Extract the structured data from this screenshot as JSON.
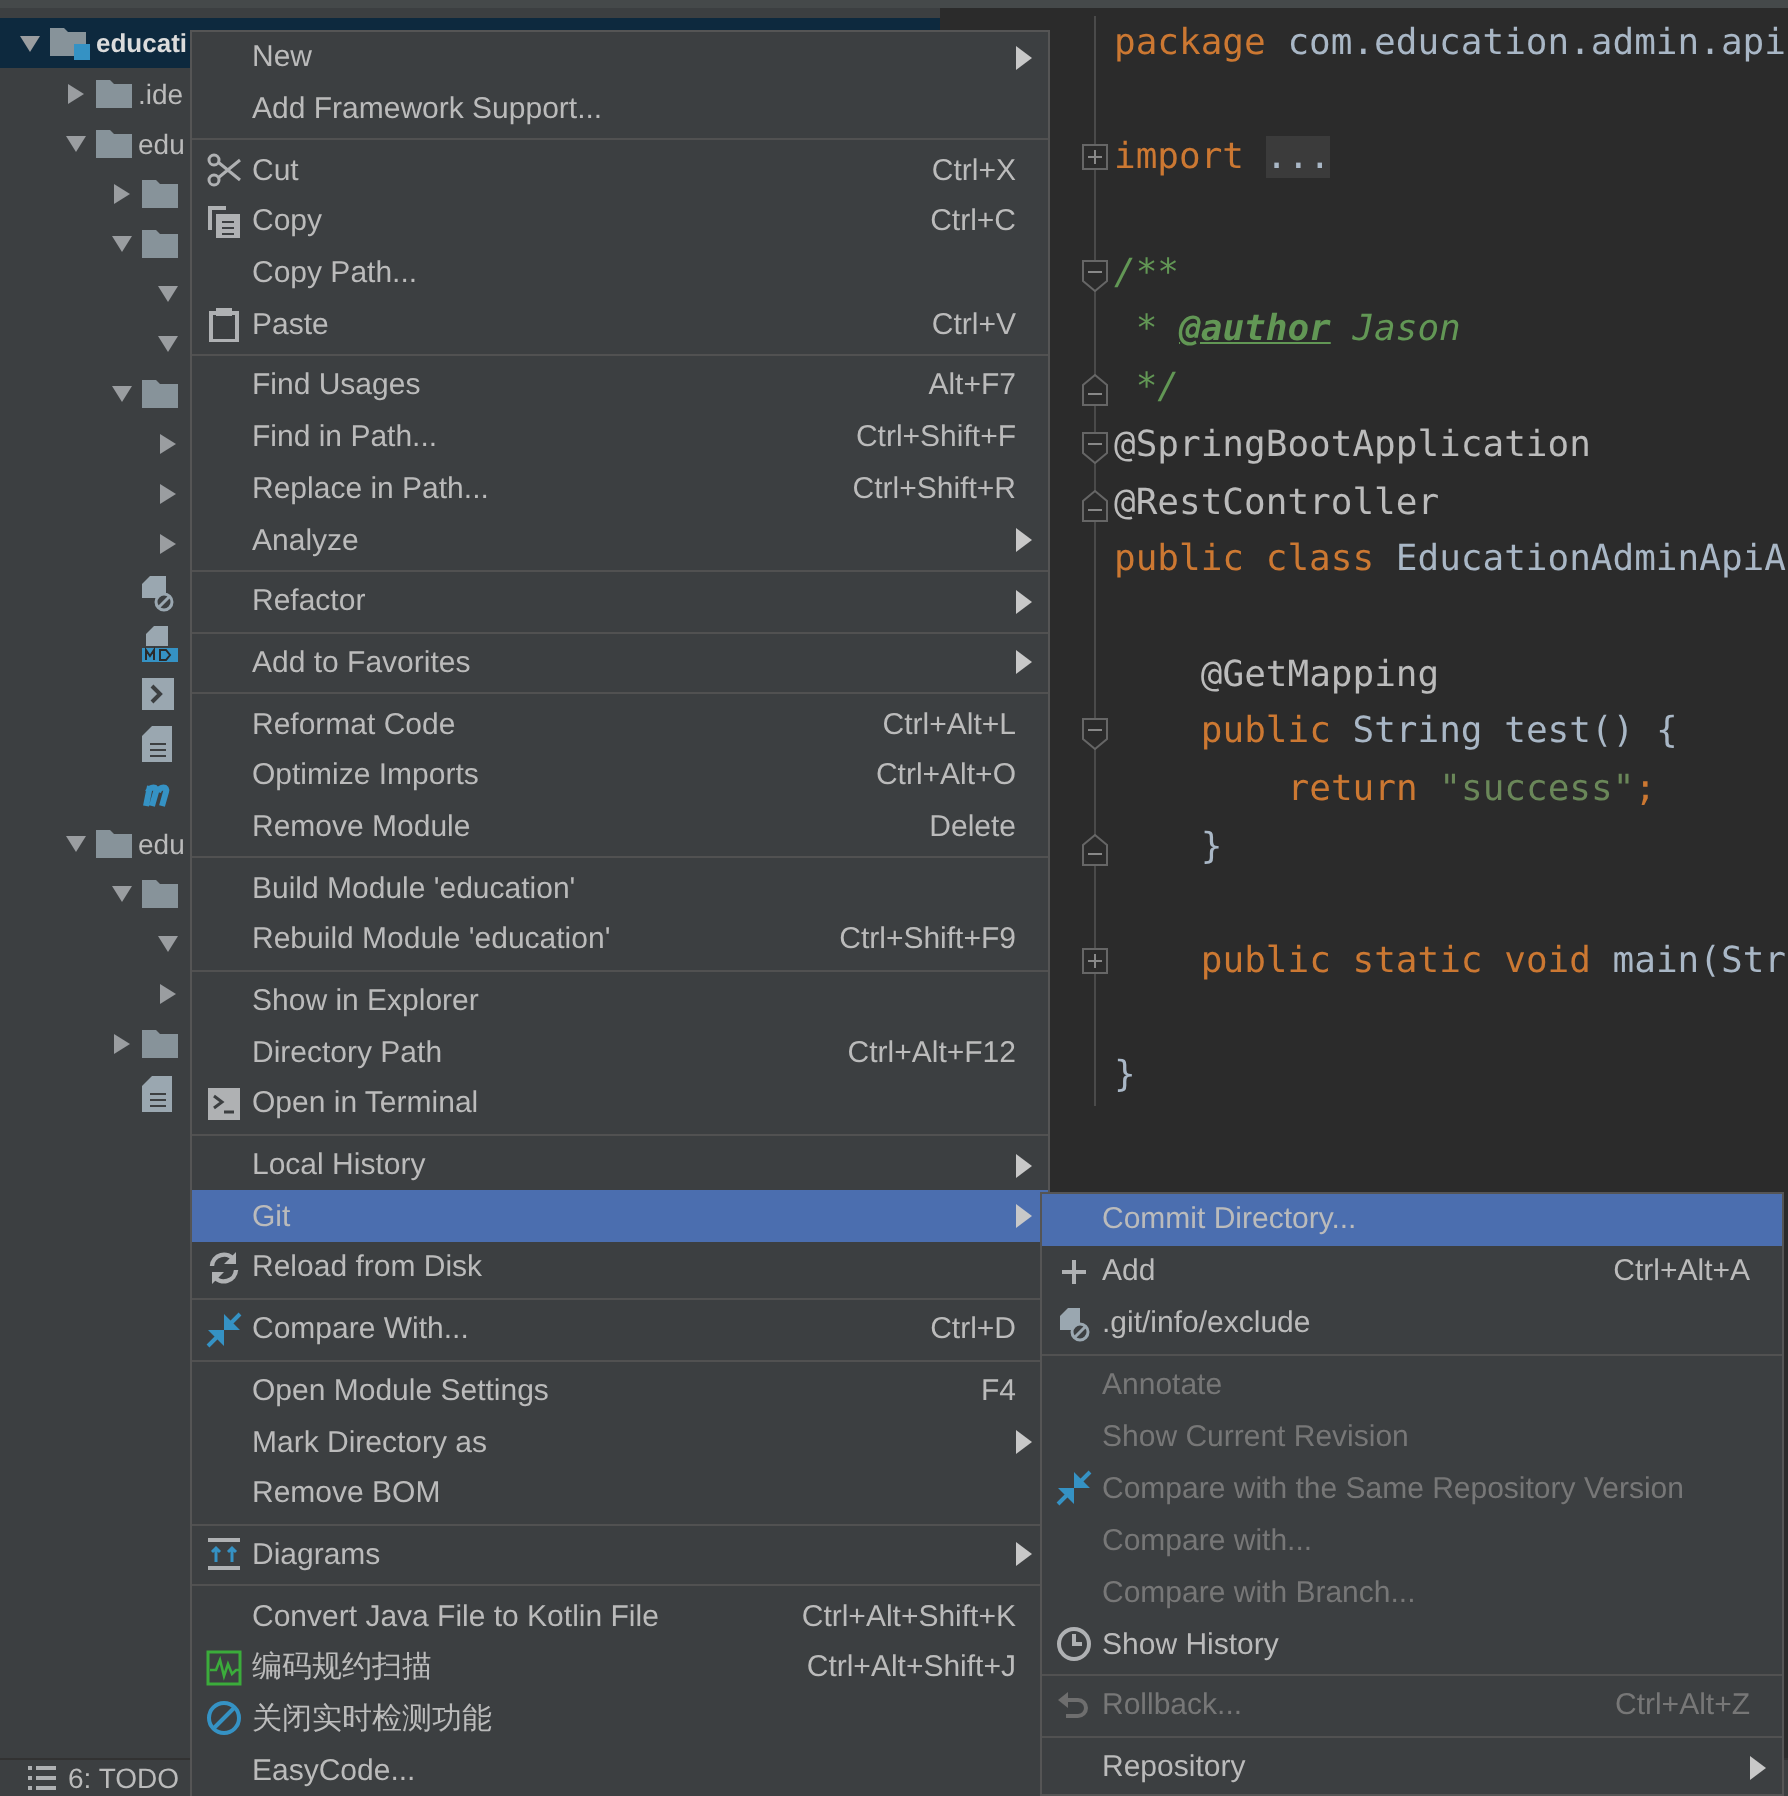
{
  "project": {
    "tree": [
      {
        "label": "educati",
        "kind": "module",
        "expanded": true,
        "selected": true,
        "children": [
          {
            "label": ".ide",
            "kind": "folder",
            "expanded": false,
            "selected": false
          },
          {
            "label": "edu",
            "kind": "folder",
            "expanded": true,
            "selected": false,
            "children": [
              {
                "kind": "folder",
                "expanded": false,
                "selected": false
              },
              {
                "kind": "folder",
                "expanded": true,
                "selected": false,
                "children": [
                  {
                    "expanded": true,
                    "selected": false
                  },
                  {
                    "expanded": true,
                    "selected": false
                  }
                ]
              },
              {
                "kind": "folder",
                "expanded": true,
                "selected": false,
                "children": [
                  {
                    "expanded": false,
                    "selected": false
                  },
                  {
                    "expanded": false,
                    "selected": false
                  },
                  {
                    "expanded": false,
                    "selected": false
                  }
                ]
              },
              {
                "kind": "excluded-file",
                "selected": false
              },
              {
                "kind": "markdown",
                "selected": false
              },
              {
                "kind": "script",
                "selected": false
              },
              {
                "kind": "file",
                "selected": false
              },
              {
                "kind": "maven",
                "selected": false
              }
            ]
          },
          {
            "label": "edu",
            "kind": "folder",
            "expanded": true,
            "selected": false,
            "children": [
              {
                "kind": "folder",
                "expanded": true,
                "selected": false,
                "children": [
                  {
                    "expanded": true,
                    "selected": false
                  },
                  {
                    "expanded": false,
                    "selected": false
                  }
                ]
              },
              {
                "kind": "folder",
                "expanded": false,
                "selected": false
              },
              {
                "kind": "file",
                "selected": false
              }
            ]
          }
        ]
      }
    ]
  },
  "editor": {
    "lines": [
      {
        "kind": "code",
        "tokens": [
          {
            "text": "package ",
            "kind": "keyword"
          },
          {
            "text": "com.education.admin.api",
            "kind": "plain"
          }
        ]
      },
      {
        "kind": "blank"
      },
      {
        "kind": "code",
        "fold": {
          "kind": "collapsed"
        },
        "tokens": [
          {
            "text": "import ",
            "kind": "keyword"
          },
          {
            "text": "...",
            "kind": "folded"
          }
        ]
      },
      {
        "kind": "blank"
      },
      {
        "kind": "code",
        "fold": {
          "kind": "start"
        },
        "tokens": [
          {
            "text": "/**",
            "kind": "comment"
          }
        ]
      },
      {
        "kind": "code",
        "tokens": [
          {
            "text": " * ",
            "kind": "comment"
          },
          {
            "text": "@author",
            "kind": "doc-tag"
          },
          {
            "text": " Jason",
            "kind": "doc-text"
          }
        ]
      },
      {
        "kind": "code",
        "fold": {
          "kind": "end"
        },
        "tokens": [
          {
            "text": " */",
            "kind": "comment"
          }
        ]
      },
      {
        "kind": "code",
        "fold": {
          "kind": "start"
        },
        "tokens": [
          {
            "text": "@SpringBootApplication",
            "kind": "annotation"
          }
        ]
      },
      {
        "kind": "code",
        "fold": {
          "kind": "end"
        },
        "tokens": [
          {
            "text": "@RestController",
            "kind": "annotation"
          }
        ]
      },
      {
        "kind": "code",
        "tokens": [
          {
            "text": "public class ",
            "kind": "keyword"
          },
          {
            "text": "EducationAdminApiA",
            "kind": "plain"
          }
        ]
      },
      {
        "kind": "blank"
      },
      {
        "kind": "indented",
        "tokens": [
          {
            "text": "@GetMapping",
            "kind": "annotation"
          }
        ]
      },
      {
        "kind": "indented",
        "fold": {
          "kind": "start"
        },
        "tokens": [
          {
            "text": "public ",
            "kind": "keyword"
          },
          {
            "text": "String test() {",
            "kind": "plain"
          }
        ]
      },
      {
        "kind": "indented-twice",
        "tokens": [
          {
            "text": "return ",
            "kind": "keyword"
          },
          {
            "text": "\"success\"",
            "kind": "string"
          },
          {
            "text": ";",
            "kind": "keyword"
          }
        ]
      },
      {
        "kind": "indented",
        "fold": {
          "kind": "end"
        },
        "tokens": [
          {
            "text": "}",
            "kind": "plain"
          }
        ]
      },
      {
        "kind": "blank"
      },
      {
        "kind": "indented",
        "fold": {
          "kind": "collapsed"
        },
        "tokens": [
          {
            "text": "public static void ",
            "kind": "keyword"
          },
          {
            "text": "main(Str",
            "kind": "plain"
          }
        ]
      },
      {
        "kind": "blank"
      },
      {
        "kind": "code",
        "tokens": [
          {
            "text": "}",
            "kind": "plain"
          }
        ]
      }
    ]
  },
  "status_bar": {
    "tool": "6: TODO"
  },
  "menu": {
    "groups": [
      {
        "items": [
          {
            "label": "New",
            "submenu": true,
            "selected": false
          },
          {
            "label": "Add Framework Support...",
            "selected": false
          }
        ]
      },
      {
        "items": [
          {
            "label": "Cut",
            "kind": "cut",
            "shortcut": "Ctrl+X",
            "selected": false
          },
          {
            "label": "Copy",
            "kind": "copy",
            "shortcut": "Ctrl+C",
            "selected": false
          },
          {
            "label": "Copy Path...",
            "selected": false
          },
          {
            "label": "Paste",
            "kind": "paste",
            "shortcut": "Ctrl+V",
            "selected": false
          }
        ]
      },
      {
        "items": [
          {
            "label": "Find Usages",
            "shortcut": "Alt+F7",
            "selected": false
          },
          {
            "label": "Find in Path...",
            "shortcut": "Ctrl+Shift+F",
            "selected": false
          },
          {
            "label": "Replace in Path...",
            "shortcut": "Ctrl+Shift+R",
            "selected": false
          },
          {
            "label": "Analyze",
            "submenu": true,
            "selected": false
          }
        ]
      },
      {
        "items": [
          {
            "label": "Refactor",
            "submenu": true,
            "selected": false
          }
        ]
      },
      {
        "items": [
          {
            "label": "Add to Favorites",
            "submenu": true,
            "selected": false
          }
        ]
      },
      {
        "items": [
          {
            "label": "Reformat Code",
            "shortcut": "Ctrl+Alt+L",
            "selected": false
          },
          {
            "label": "Optimize Imports",
            "shortcut": "Ctrl+Alt+O",
            "selected": false
          },
          {
            "label": "Remove Module",
            "shortcut": "Delete",
            "selected": false
          }
        ]
      },
      {
        "items": [
          {
            "label": "Build Module 'education'",
            "selected": false
          },
          {
            "label": "Rebuild Module 'education'",
            "shortcut": "Ctrl+Shift+F9",
            "selected": false
          }
        ]
      },
      {
        "items": [
          {
            "label": "Show in Explorer",
            "selected": false
          },
          {
            "label": "Directory Path",
            "shortcut": "Ctrl+Alt+F12",
            "selected": false
          },
          {
            "label": "Open in Terminal",
            "kind": "terminal",
            "selected": false
          }
        ]
      },
      {
        "items": [
          {
            "label": "Local History",
            "submenu": true,
            "selected": false
          },
          {
            "label": "Git",
            "submenu": true,
            "selected": true
          },
          {
            "label": "Reload from Disk",
            "kind": "reload",
            "selected": false
          }
        ]
      },
      {
        "items": [
          {
            "label": "Compare With...",
            "kind": "compare",
            "shortcut": "Ctrl+D",
            "selected": false
          }
        ]
      },
      {
        "items": [
          {
            "label": "Open Module Settings",
            "shortcut": "F4",
            "selected": false
          },
          {
            "label": "Mark Directory as",
            "submenu": true,
            "selected": false
          },
          {
            "label": "Remove BOM",
            "selected": false
          }
        ]
      },
      {
        "items": [
          {
            "label": "Diagrams",
            "kind": "diagrams",
            "submenu": true,
            "selected": false
          }
        ]
      },
      {
        "items": [
          {
            "label": "Convert Java File to Kotlin File",
            "shortcut": "Ctrl+Alt+Shift+K",
            "selected": false
          },
          {
            "label": "编码规约扫描",
            "kind": "scan",
            "shortcut": "Ctrl+Alt+Shift+J",
            "selected": false
          },
          {
            "label": "关闭实时检测功能",
            "kind": "ban",
            "selected": false
          },
          {
            "label": "EasyCode...",
            "selected": false
          }
        ]
      }
    ]
  },
  "git_submenu": {
    "groups": [
      {
        "items": [
          {
            "label": "Commit Directory...",
            "selected": true,
            "disabled": false
          },
          {
            "label": "Add",
            "kind": "plus",
            "shortcut": "Ctrl+Alt+A",
            "selected": false,
            "disabled": false
          },
          {
            "label": ".git/info/exclude",
            "kind": "excluded-file",
            "selected": false,
            "disabled": false
          }
        ]
      },
      {
        "items": [
          {
            "label": "Annotate",
            "selected": false,
            "disabled": true
          },
          {
            "label": "Show Current Revision",
            "selected": false,
            "disabled": true
          },
          {
            "label": "Compare with the Same Repository Version",
            "kind": "compare",
            "selected": false,
            "disabled": true
          },
          {
            "label": "Compare with...",
            "selected": false,
            "disabled": true
          },
          {
            "label": "Compare with Branch...",
            "selected": false,
            "disabled": true
          },
          {
            "label": "Show History",
            "kind": "clock",
            "selected": false,
            "disabled": false
          }
        ]
      },
      {
        "items": [
          {
            "label": "Rollback...",
            "kind": "undo",
            "shortcut": "Ctrl+Alt+Z",
            "selected": false,
            "disabled": true
          }
        ]
      },
      {
        "items": [
          {
            "label": "Repository",
            "submenu": true,
            "selected": false,
            "disabled": false
          }
        ]
      }
    ]
  }
}
